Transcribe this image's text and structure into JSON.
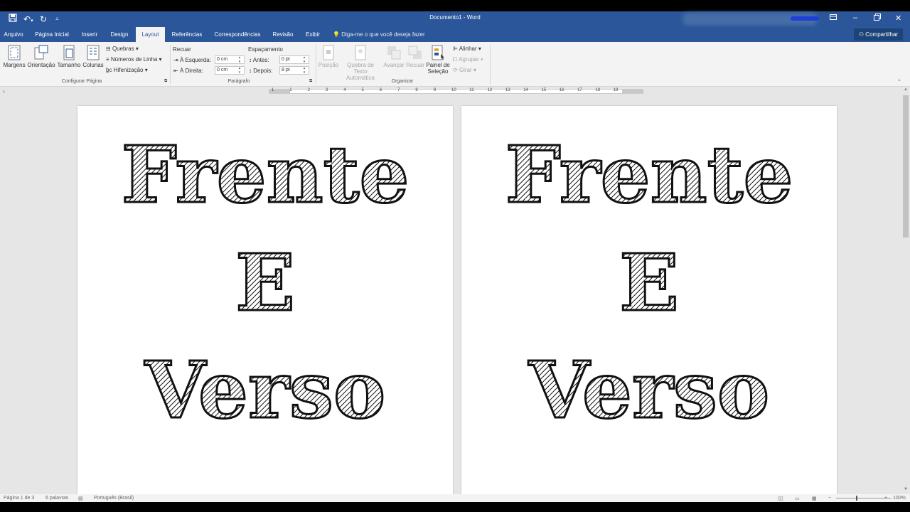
{
  "titlebar": {
    "title": "Documento1 - Word"
  },
  "tabs": {
    "file": "Arquivo",
    "home": "Página Inicial",
    "insert": "Inserir",
    "design": "Design",
    "layout": "Layout",
    "references": "Referências",
    "mailings": "Correspondências",
    "review": "Revisão",
    "view": "Exibir",
    "tell_me": "Diga-me o que você deseja fazer",
    "share": "Compartilhar"
  },
  "ribbon": {
    "page_setup": {
      "margins": "Margens",
      "orientation": "Orientação",
      "size": "Tamanho",
      "columns": "Colunas",
      "breaks": "Quebras",
      "line_numbers": "Números de Linha",
      "hyphenation": "Hifenização",
      "group_label": "Configurar Página"
    },
    "paragraph": {
      "indent_label": "Recuar",
      "left_label": "À Esquerda:",
      "left_value": "0 cm",
      "right_label": "À Direita:",
      "right_value": "0 cm",
      "spacing_label": "Espaçamento",
      "before_label": "Antes:",
      "before_value": "0 pt",
      "after_label": "Depois:",
      "after_value": "8 pt",
      "group_label": "Parágrafo"
    },
    "arrange": {
      "position": "Posição",
      "wrap_text_1": "Quebra de Texto",
      "wrap_text_2": "Automática",
      "bring_forward": "Avançar",
      "send_backward": "Recuar",
      "selection_pane_1": "Painel de",
      "selection_pane_2": "Seleção",
      "align": "Alinhar",
      "group": "Agrupar",
      "rotate": "Girar",
      "group_label": "Organizar"
    }
  },
  "ruler": {
    "ticks": [
      "1",
      "1",
      "2",
      "3",
      "4",
      "5",
      "6",
      "7",
      "8",
      "9",
      "10",
      "11",
      "12",
      "13",
      "14",
      "15",
      "16",
      "17",
      "18",
      "19"
    ]
  },
  "pages": [
    {
      "line1": "Frente",
      "line2": "E",
      "line3": "Verso"
    },
    {
      "line1": "Frente",
      "line2": "E",
      "line3": "Verso"
    }
  ],
  "status": {
    "page": "Página 1 de 3",
    "words": "6 palavras",
    "language": "Português (Brasil)",
    "zoom": "100%"
  },
  "colors": {
    "brand": "#2b579a",
    "ribbon_bg": "#f3f3f3",
    "doc_bg": "#e6e6e6"
  }
}
